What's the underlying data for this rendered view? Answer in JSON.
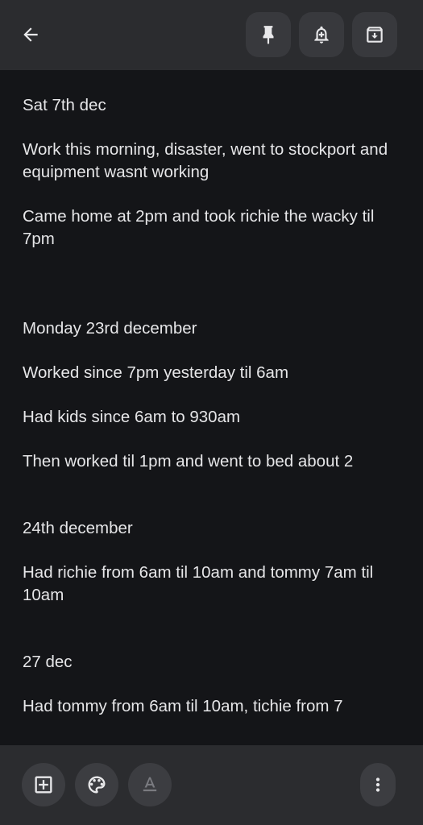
{
  "toolbar": {
    "back_icon": "arrow-back-icon",
    "actions": [
      {
        "name": "pin-icon"
      },
      {
        "name": "reminder-icon"
      },
      {
        "name": "archive-icon"
      }
    ]
  },
  "note": {
    "lines": [
      "Sat 7th dec",
      "Work this morning, disaster, went to stockport and equipment wasnt working",
      "Came home at 2pm and took richie the wacky til 7pm",
      "Monday 23rd december",
      "Worked since 7pm yesterday til 6am",
      "Had kids since 6am to 930am",
      "Then worked til 1pm and went to bed about 2",
      "24th december",
      "Had richie from 6am til 10am and tommy 7am til 10am",
      "27 dec",
      "Had tommy from 6am til 10am, tichie from 7"
    ]
  },
  "bottom_bar": {
    "add_icon": "add-box-icon",
    "palette_icon": "palette-icon",
    "text_format_icon": "text-format-icon",
    "more_icon": "more-vert-icon"
  },
  "colors": {
    "background": "#141518",
    "bar": "#2b2c2f",
    "button": "#38393d",
    "text": "#e6e6e8"
  }
}
